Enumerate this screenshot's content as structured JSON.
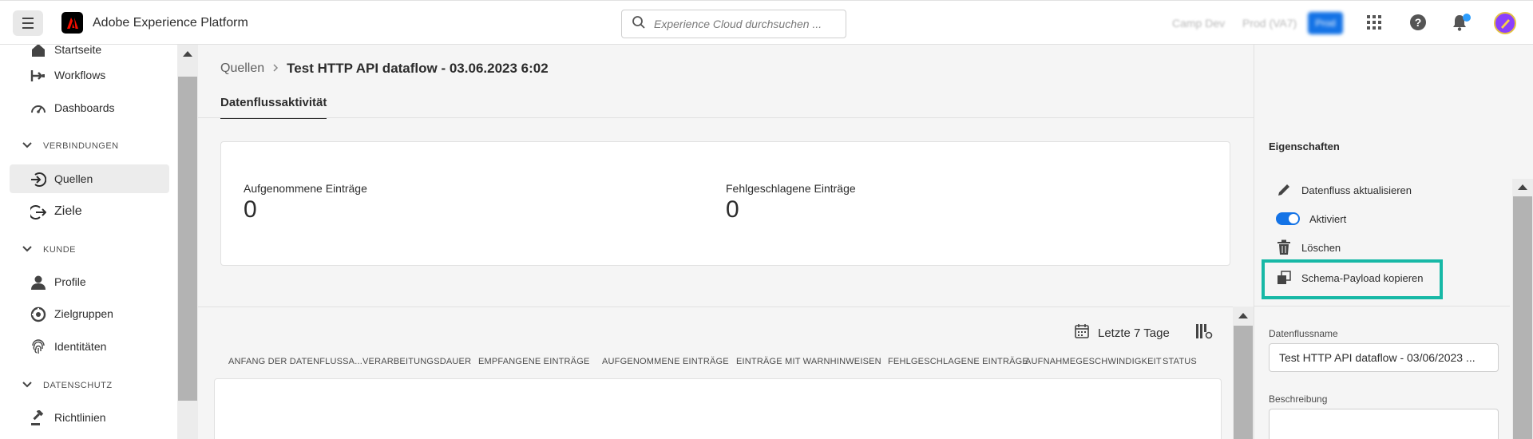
{
  "header": {
    "app_title": "Adobe Experience Platform",
    "search_placeholder": "Experience Cloud durchsuchen ...",
    "org_name": "Camp Dev",
    "sandbox_name": "Prod (VA7)",
    "sandbox_badge": "Prod",
    "accent_color": "#1473e6"
  },
  "sidebar": {
    "items": [
      {
        "label": "Startseite",
        "icon": "home-icon"
      },
      {
        "label": "Workflows",
        "icon": "workflow-icon"
      },
      {
        "label": "Dashboards",
        "icon": "dashboard-icon"
      },
      {
        "label": "Quellen",
        "icon": "sources-icon",
        "active": true
      },
      {
        "label": "Ziele",
        "icon": "destinations-icon"
      },
      {
        "label": "Profile",
        "icon": "profile-icon"
      },
      {
        "label": "Zielgruppen",
        "icon": "audiences-icon"
      },
      {
        "label": "Identitäten",
        "icon": "fingerprint-icon"
      },
      {
        "label": "Richtlinien",
        "icon": "gavel-icon"
      }
    ],
    "sections": [
      "VERBINDUNGEN",
      "KUNDE",
      "DATENSCHUTZ"
    ]
  },
  "main": {
    "breadcrumb_parent": "Quellen",
    "title": "Test HTTP API dataflow - 03.06.2023 6:02",
    "tab": "Datenflussaktivität",
    "metrics": [
      {
        "label": "Aufgenommene Einträge",
        "value": "0"
      },
      {
        "label": "Fehlgeschlagene Einträge",
        "value": "0"
      }
    ],
    "date_filter": "Letzte 7 Tage",
    "columns": [
      "ANFANG DER DATENFLUSSA...",
      "VERARBEITUNGSDAUER",
      "EMPFANGENE EINTRÄGE",
      "AUFGENOMMENE EINTRÄGE",
      "EINTRÄGE MIT WARNHINWEISEN",
      "FEHLGESCHLAGENE EINTRÄGE",
      "AUFNAHMEGESCHWINDIGKEIT",
      "STATUS"
    ]
  },
  "properties": {
    "title": "Eigenschaften",
    "actions": {
      "update": "Datenfluss aktualisieren",
      "enabled": "Aktiviert",
      "delete": "Löschen",
      "copy_schema": "Schema-Payload kopieren"
    },
    "enabled_state": true,
    "dataflow_name_label": "Datenflussname",
    "dataflow_name_value": "Test HTTP API dataflow - 03/06/2023 ...",
    "description_label": "Beschreibung",
    "description_value": "",
    "highlight_color": "#17b8a6"
  }
}
